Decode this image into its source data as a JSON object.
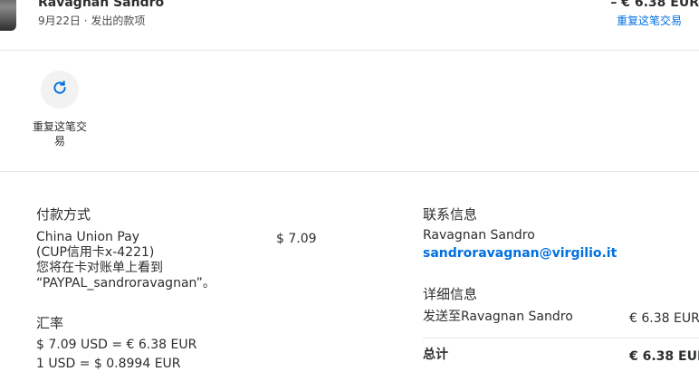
{
  "header": {
    "merchant_name": "Ravagnan Sandro",
    "date_type": "9月22日 · 发出的款项",
    "amount": "– € 6.38 EUR",
    "repeat_link": "重复这笔交易"
  },
  "actions": {
    "repeat": {
      "label": "重复这笔交易",
      "icon": "refresh-icon"
    }
  },
  "payment_method": {
    "title": "付款方式",
    "lines": [
      "China Union Pay",
      "(CUP信用卡x-4221)",
      "您将在卡对账单上看到",
      "“PAYPAL_sandroravagnan”。"
    ],
    "amount": "$ 7.09"
  },
  "exchange_rate": {
    "title": "汇率",
    "line1": "$ 7.09 USD = € 6.38 EUR",
    "line2": "1 USD = $ 0.8994 EUR"
  },
  "contact": {
    "title": "联系信息",
    "name": "Ravagnan Sandro",
    "email": "sandroravagnan@virgilio.it"
  },
  "details": {
    "title": "详细信息",
    "row_label": "发送至Ravagnan Sandro",
    "row_amount": "€ 6.38 EUR",
    "total_label": "总计",
    "total_amount": "€ 6.38 EUR"
  },
  "colors": {
    "link": "#0070e0",
    "text": "#2c2e2f",
    "divider": "#e6e6e6"
  }
}
